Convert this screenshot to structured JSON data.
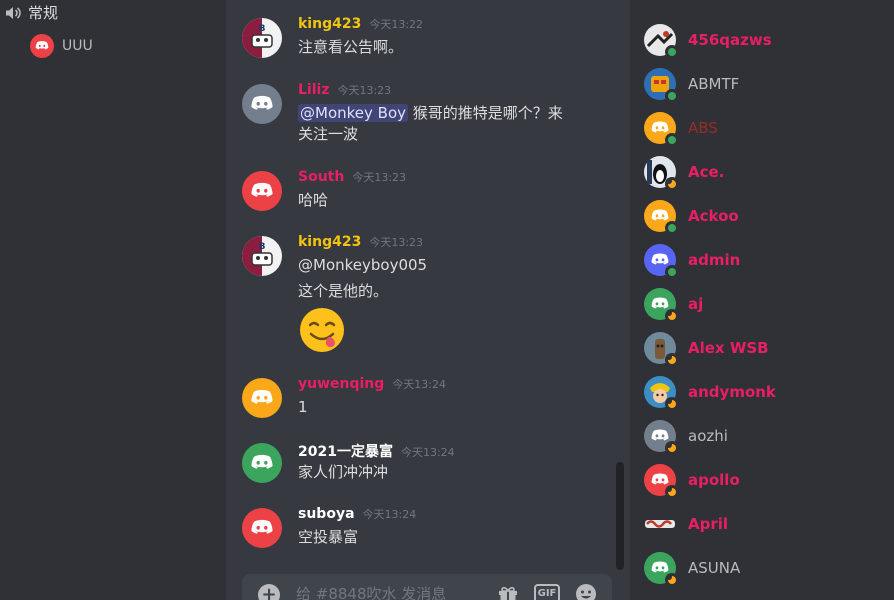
{
  "colors": {
    "discord_blurple": "#5865f2",
    "discord_red": "#ed4245",
    "discord_grey": "#747f8d",
    "discord_orange": "#faa81a",
    "discord_green": "#3ba55d",
    "name_yellow": "#f1c40f",
    "name_pink": "#e91e63",
    "name_white": "#ffffff",
    "name_grey": "#b9bbbe",
    "name_darkred": "#992d22"
  },
  "sidebar": {
    "category_label": "常规",
    "voice_user": "UUU"
  },
  "messages": [
    {
      "author": "king423",
      "time": "今天13:22",
      "lines": [
        "注意看公告啊。"
      ]
    },
    {
      "author": "Liliz",
      "time": "今天13:23",
      "mention": "@Monkey Boy",
      "lines": [
        "猴哥的推特是哪个？来",
        "关注一波"
      ]
    },
    {
      "author": "South",
      "time": "今天13:23",
      "lines": [
        "哈哈"
      ]
    },
    {
      "author": "king423",
      "time": "今天13:23",
      "lines": [
        "@Monkeyboy005",
        "这个是他的。"
      ],
      "emoji": "yum-emoji"
    },
    {
      "author": "yuwenqing",
      "time": "今天13:24",
      "lines": [
        "1"
      ]
    },
    {
      "author": "2021一定暴富",
      "time": "今天13:24",
      "lines": [
        "家人们冲冲冲"
      ]
    },
    {
      "author": "suboya",
      "time": "今天13:24",
      "lines": [
        "空投暴富"
      ]
    }
  ],
  "input": {
    "placeholder": "给 #8848吹水 发消息"
  },
  "toolbar": {
    "gif_label": "GIF"
  },
  "members": [
    {
      "name": "456qazws"
    },
    {
      "name": "ABMTF"
    },
    {
      "name": "ABS"
    },
    {
      "name": "Ace."
    },
    {
      "name": "Ackoo"
    },
    {
      "name": "admin"
    },
    {
      "name": "aj"
    },
    {
      "name": "Alex WSB"
    },
    {
      "name": "andymonk"
    },
    {
      "name": "aozhi"
    },
    {
      "name": "apollo"
    },
    {
      "name": "April"
    },
    {
      "name": "ASUNA"
    }
  ]
}
